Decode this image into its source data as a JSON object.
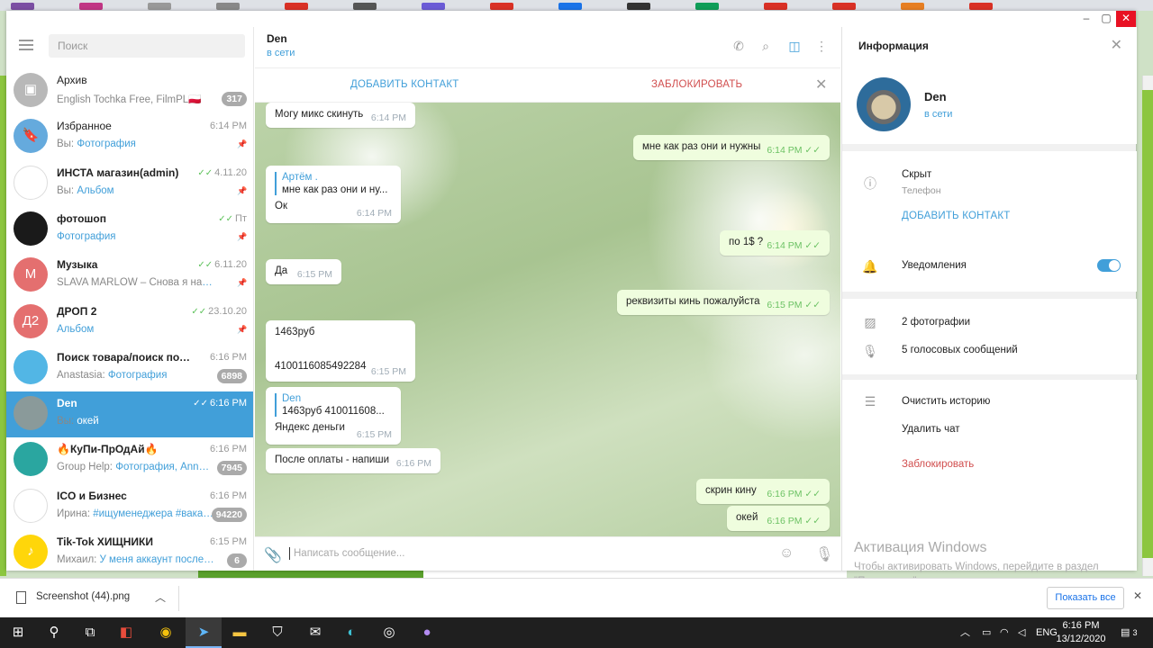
{
  "left_panel": {
    "search_placeholder": "Поиск",
    "chats": [
      {
        "name": "Архив",
        "preview": "English Tochka Free, FilmPL🇵🇱",
        "time": "",
        "badge": "317",
        "avatar_color": "#b8b8b8",
        "avatar_text": "▣"
      },
      {
        "name": "Избранное",
        "preview_prefix": "Вы: ",
        "preview": "Фотография",
        "time": "6:14 PM",
        "pinned": true,
        "avatar_color": "#65aadd",
        "avatar_text": "🔖"
      },
      {
        "name": "ИНСТА магазин(admin)",
        "preview_prefix": "Вы: ",
        "preview": "Альбом",
        "time": "4.11.20",
        "check": true,
        "pinned": true,
        "avatar_color": "#ffffff",
        "avatar_text": ""
      },
      {
        "name": "фотошоп",
        "preview": "Фотография",
        "time": "Пт",
        "check": true,
        "pinned": true,
        "avatar_color": "#1a1a1a",
        "avatar_text": ""
      },
      {
        "name": "Музыка",
        "preview": "SLAVA MARLOW – Снова я напиваюсь",
        "time": "6.11.20",
        "check": true,
        "pinned": true,
        "avatar_color": "#e46f6f",
        "avatar_text": "М"
      },
      {
        "name": "ДРОП 2",
        "preview": "Альбом",
        "time": "23.10.20",
        "check": true,
        "pinned": true,
        "avatar_color": "#e46f6f",
        "avatar_text": "Д2"
      },
      {
        "name": "Поиск товара/поиск поставщика",
        "preview_prefix": "Anastasia: ",
        "preview": "Фотография",
        "time": "6:16 PM",
        "badge": "6898",
        "avatar_color": "#52b6e5",
        "avatar_text": ""
      },
      {
        "name": "Den",
        "preview_prefix": "Вы: ",
        "preview": "окей",
        "time": "6:16 PM",
        "check": true,
        "active": true,
        "avatar_color": "#8a9a9a",
        "avatar_text": ""
      },
      {
        "name": "🔥КуПи-ПрОдАй🔥",
        "preview_prefix": "Group Help: ",
        "preview": "Фотография, Ann…",
        "time": "6:16 PM",
        "badge": "7945",
        "avatar_color": "#2aa6a0",
        "avatar_text": ""
      },
      {
        "name": "ICO и Бизнес",
        "preview_prefix": "Ирина: ",
        "preview": "#ищуменеджера #вакан…",
        "time": "6:16 PM",
        "badge": "94220",
        "avatar_color": "#ffffff",
        "avatar_text": ""
      },
      {
        "name": "Tik-Tok ХИЩНИКИ",
        "preview_prefix": "Михаил: ",
        "preview": "У меня аккаунт после модерации",
        "time": "6:15 PM",
        "badge": "6",
        "avatar_color": "#ffd60a",
        "avatar_text": "♪"
      }
    ]
  },
  "chat": {
    "name": "Den",
    "status": "в сети",
    "add_contact": "ДОБАВИТЬ КОНТАКТ",
    "block": "ЗАБЛОКИРОВАТЬ",
    "compose_placeholder": "Написать сообщение...",
    "messages": [
      {
        "text": "Могу микс скинуть",
        "time": "6:14 PM",
        "out": false
      },
      {
        "text": "мне как раз они и нужны",
        "time": "6:14 PM",
        "out": true
      },
      {
        "reply_name": "Артём .",
        "reply_text": "мне как раз они и ну...",
        "text": "Ок",
        "time": "6:14 PM",
        "out": false
      },
      {
        "text": "по 1$ ?",
        "time": "6:14 PM",
        "out": true
      },
      {
        "text": "Да",
        "time": "6:15 PM",
        "out": false
      },
      {
        "text": "реквизиты кинь пожалуйста",
        "time": "6:15 PM",
        "out": true
      },
      {
        "line1": "1463руб",
        "line2": "4100116085492284",
        "time": "6:15 PM",
        "out": false
      },
      {
        "reply_name": "Den",
        "reply_text": "1463руб    410011608...",
        "text": "Яндекс деньги",
        "time": "6:15 PM",
        "out": false
      },
      {
        "text": "После оплаты - напиши",
        "time": "6:16 PM",
        "out": false
      },
      {
        "text": "скрин кину",
        "time": "6:16 PM",
        "out": true
      },
      {
        "text": "окей",
        "time": "6:16 PM",
        "out": true
      }
    ]
  },
  "info_panel": {
    "title": "Информация",
    "name": "Den",
    "status": "в сети",
    "phone_value": "Скрыт",
    "phone_label": "Телефон",
    "add_contact": "ДОБАВИТЬ КОНТАКТ",
    "notifications": "Уведомления",
    "notifications_on": true,
    "photos": "2 фотографии",
    "voice": "5 голосовых сообщений",
    "clear_history": "Очистить историю",
    "delete_chat": "Удалить чат",
    "block": "Заблокировать"
  },
  "watermark": {
    "title": "Активация Windows",
    "text": "Чтобы активировать Windows, перейдите в раздел \"Параметры\"."
  },
  "download_bar": {
    "file": "Screenshot (44).png",
    "show_all": "Показать все"
  },
  "taskbar": {
    "lang": "ENG",
    "time": "6:16 PM",
    "date": "13/12/2020",
    "notifications": "3"
  },
  "colors": {
    "accent": "#419fd9",
    "danger": "#d14e4e",
    "out_bubble": "#effdde",
    "check": "#5ec25b"
  }
}
